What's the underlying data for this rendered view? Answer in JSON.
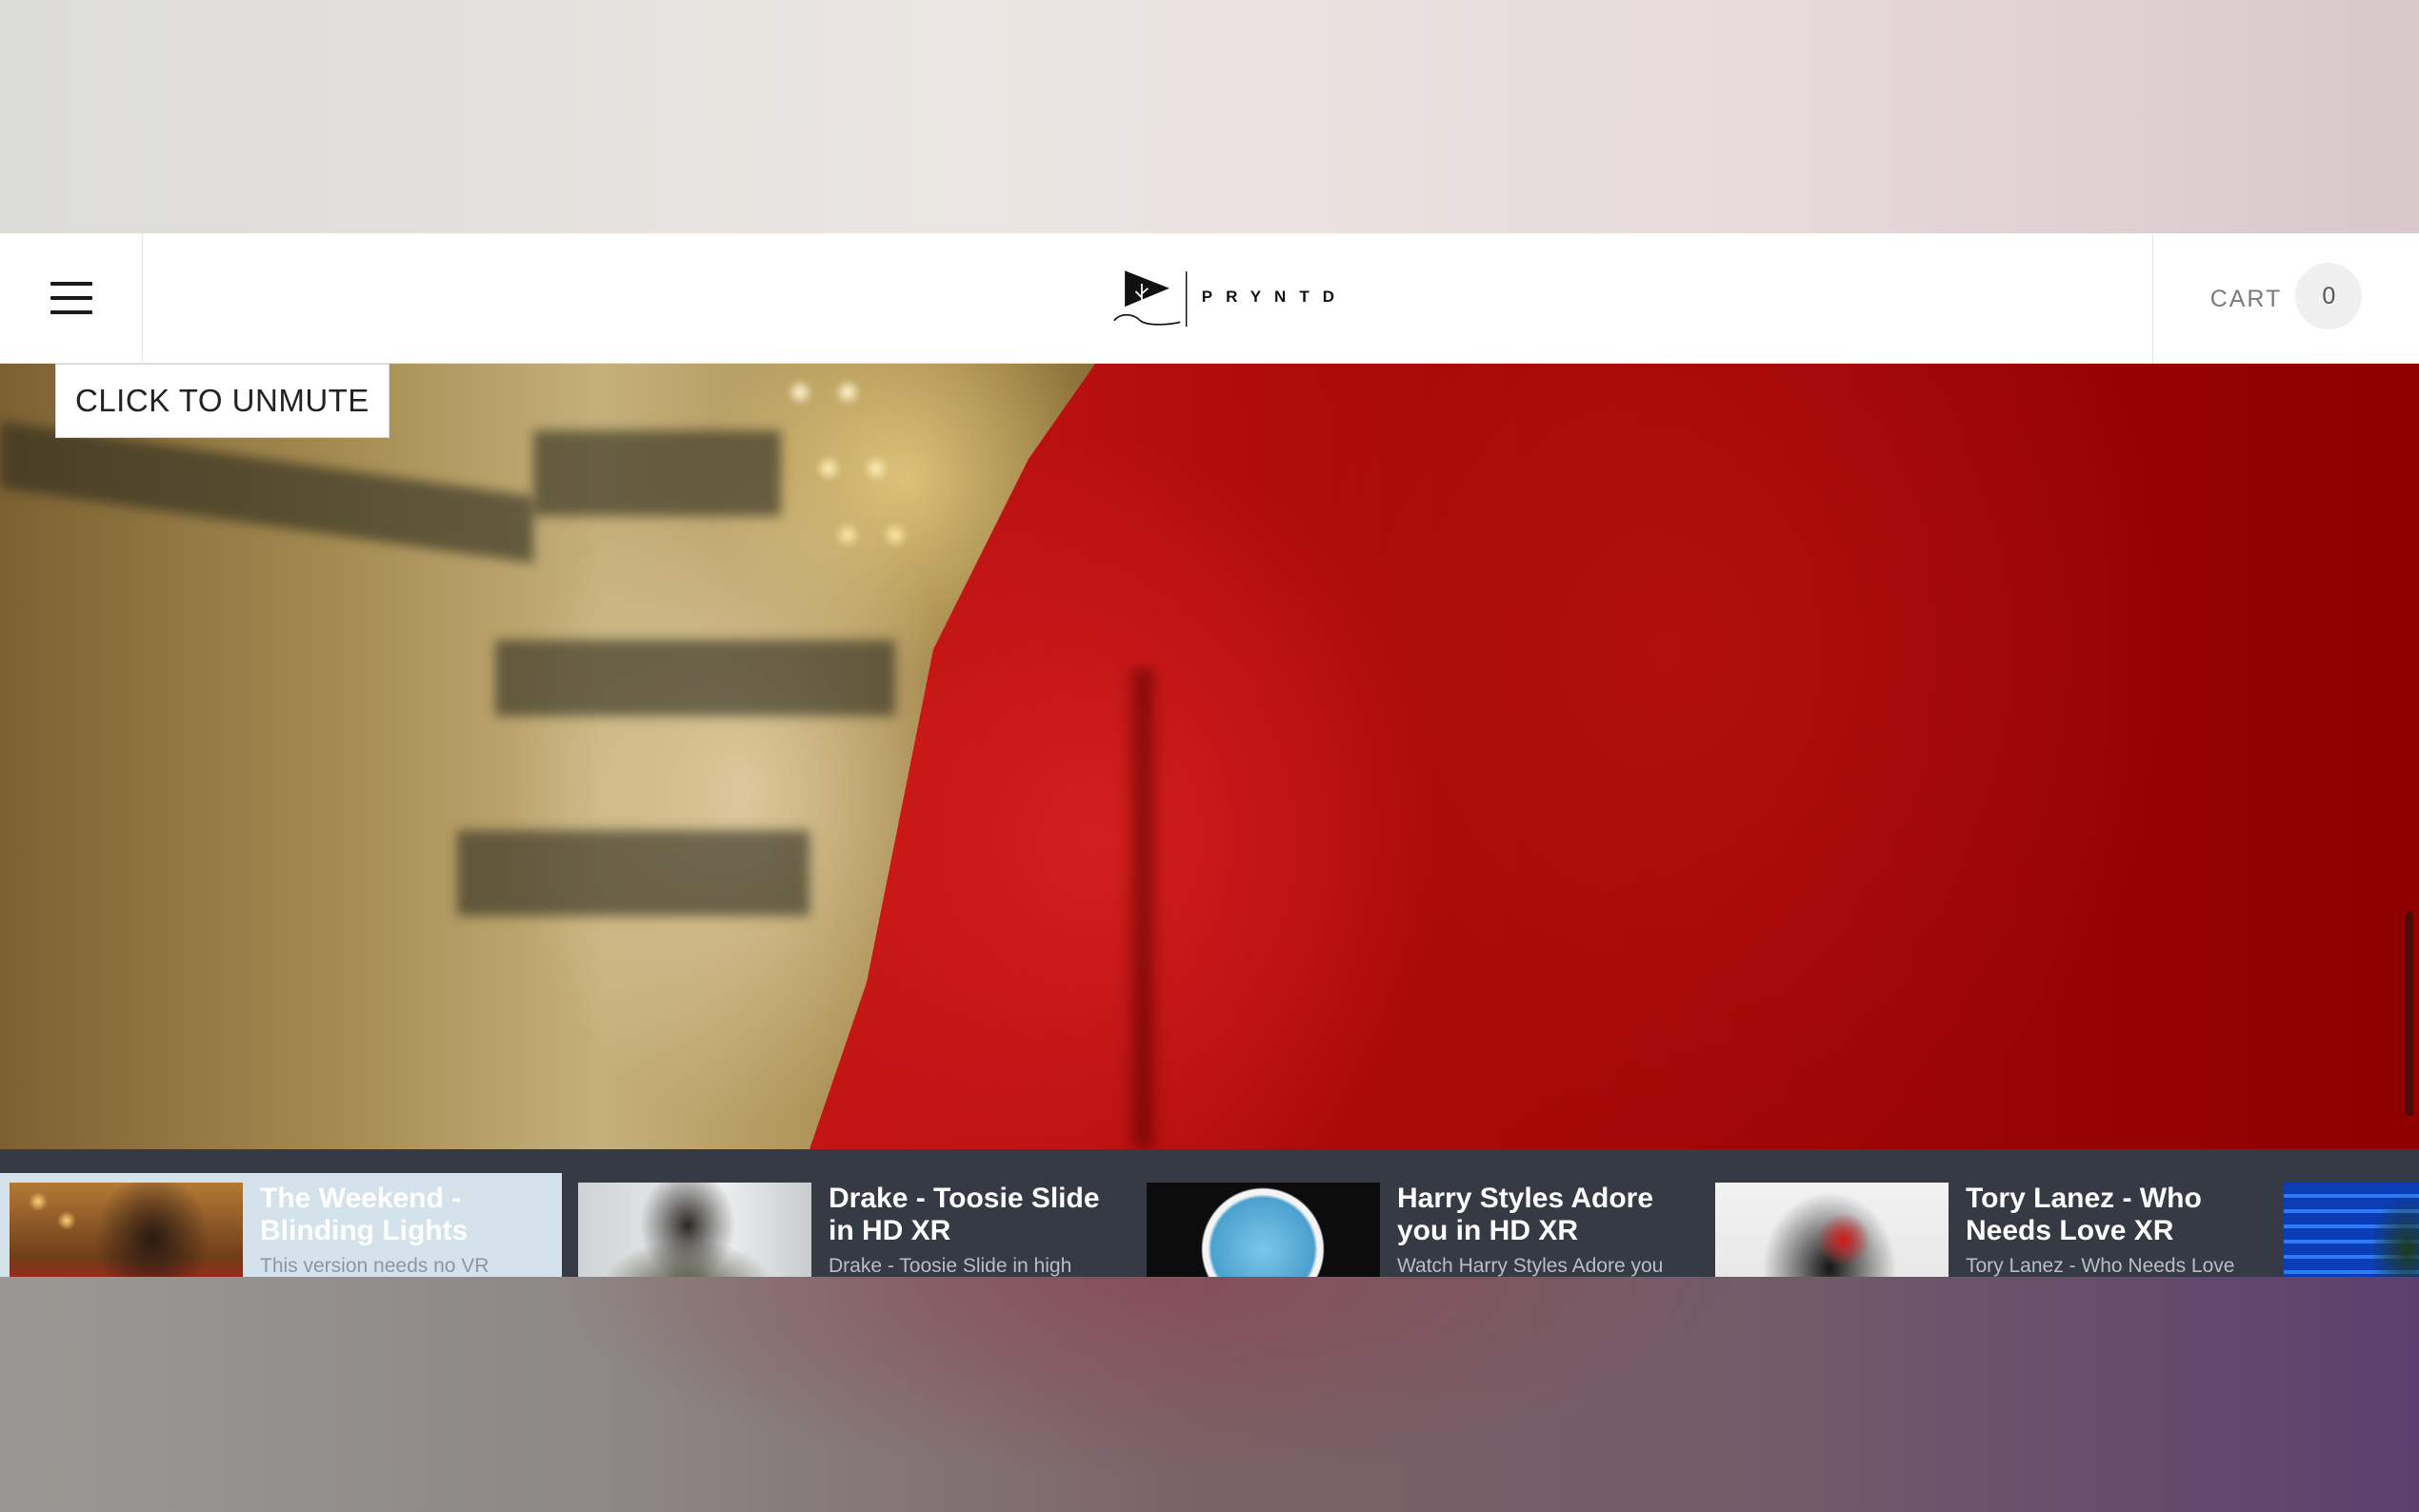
{
  "header": {
    "menu_icon": "hamburger-menu-icon",
    "logo_text": "PRYNTD",
    "cart_label": "CART",
    "cart_count": "0"
  },
  "video": {
    "unmute_label": "CLICK TO UNMUTE"
  },
  "carousel": {
    "items": [
      {
        "title": "The Weekend - Blinding Lights",
        "subtitle": "This version needs no VR",
        "active": true
      },
      {
        "title": "Drake - Toosie Slide in HD XR",
        "subtitle": "Drake - Toosie Slide in high",
        "active": false
      },
      {
        "title": "Harry Styles Adore you in HD XR",
        "subtitle": "Watch Harry Styles Adore you",
        "active": false
      },
      {
        "title": "Tory Lanez - Who Needs Love XR",
        "subtitle": "Tory Lanez - Who Needs Love",
        "active": false
      },
      {
        "title": "",
        "subtitle": "",
        "active": false
      }
    ]
  },
  "colors": {
    "carousel_bg": "#353a45",
    "active_card_bg": "#d4e2ec",
    "header_bg": "#ffffff"
  }
}
